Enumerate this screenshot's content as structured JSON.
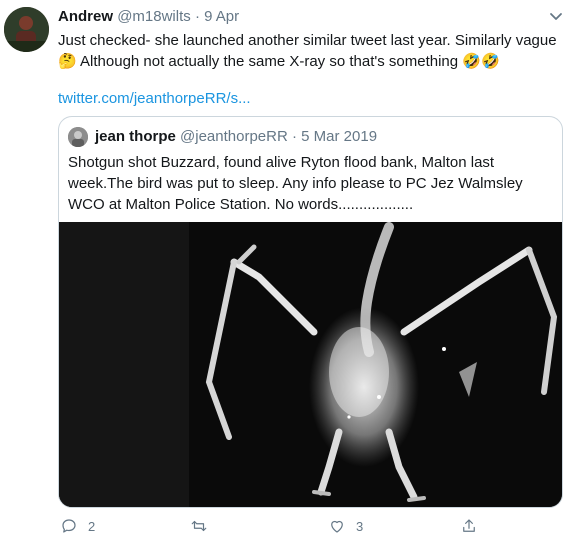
{
  "tweet": {
    "author_name": "Andrew",
    "author_handle": "@m18wilts",
    "separator": "·",
    "date": "9 Apr",
    "text_line1": "Just checked- she launched another similar tweet last year. Similarly vague",
    "text_line2": "Although not actually the same X-ray so that's something",
    "emoji_thinking": "🤔",
    "emoji_laughing": "🤣🤣",
    "link": "twitter.com/jeanthorpeRR/s..."
  },
  "quoted_tweet": {
    "author_name": "jean thorpe",
    "author_handle": "@jeanthorpeRR",
    "separator": "·",
    "date": "5 Mar 2019",
    "text": "Shotgun shot Buzzard, found alive Ryton flood bank, Malton last week.The bird was put to sleep. Any info please to PC Jez Walmsley WCO at Malton Police Station. No words..................",
    "image_description_icon": "xray-buzzard-image"
  },
  "actions": {
    "reply_count": "2",
    "retweet_count": "",
    "like_count": "3",
    "share_count": ""
  },
  "colors": {
    "link": "#1b95e0",
    "secondary_text": "#657786",
    "border": "#ccd6dd"
  }
}
